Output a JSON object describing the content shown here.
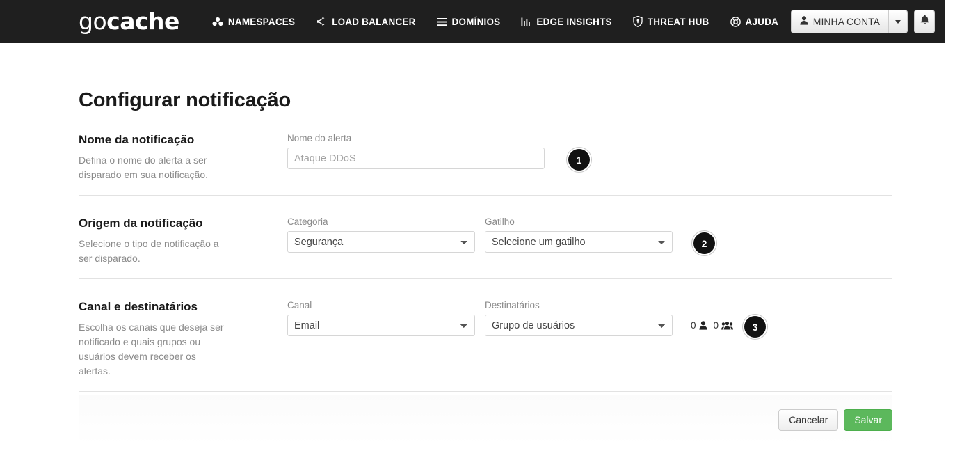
{
  "navbar": {
    "brand_go": "go",
    "brand_cache": "cache",
    "links": [
      {
        "label": "NAMESPACES",
        "icon": "cubes-icon"
      },
      {
        "label": "LOAD BALANCER",
        "icon": "share-nodes-icon"
      },
      {
        "label": "DOMÍNIOS",
        "icon": "bars-icon"
      },
      {
        "label": "EDGE INSIGHTS",
        "icon": "chart-bar-icon"
      },
      {
        "label": "THREAT HUB",
        "icon": "shield-icon"
      },
      {
        "label": "AJUDA",
        "icon": "life-ring-icon"
      }
    ],
    "account_label": "MINHA CONTA",
    "account_icon": "user-icon",
    "caret_icon": "caret-down-icon",
    "bell_icon": "bell-icon",
    "background_color": "#1f1f1f"
  },
  "page": {
    "title": "Configurar notificação"
  },
  "sections": [
    {
      "title": "Nome da notificação",
      "description": "Defina o nome do alerta a ser disparado em sua notificação.",
      "badge": "1",
      "fields": [
        {
          "label": "Nome do alerta",
          "type": "text",
          "value": "",
          "placeholder": "Ataque DDoS"
        }
      ]
    },
    {
      "title": "Origem da notificação",
      "description": "Selecione o tipo de notificação a ser disparado.",
      "badge": "2",
      "fields": [
        {
          "label": "Categoria",
          "type": "select",
          "value": "Segurança",
          "options": [
            "Segurança"
          ]
        },
        {
          "label": "Gatilho",
          "type": "select",
          "value": "Selecione um gatilho",
          "options": [
            "Selecione um gatilho"
          ]
        }
      ]
    },
    {
      "title": "Canal e destinatários",
      "description": "Escolha os canais que deseja ser notificado e quais grupos ou usuários devem receber os alertas.",
      "badge": "3",
      "fields": [
        {
          "label": "Canal",
          "type": "select",
          "value": "Email",
          "options": [
            "Email"
          ]
        },
        {
          "label": "Destinatários",
          "type": "select",
          "value": "Grupo de usuários",
          "options": [
            "Grupo de usuários"
          ]
        }
      ],
      "counters": [
        {
          "count": "0",
          "icon": "user-icon"
        },
        {
          "count": "0",
          "icon": "users-group-icon"
        }
      ]
    }
  ],
  "footer": {
    "cancel_label": "Cancelar",
    "save_label": "Salvar",
    "save_color": "#5cb85c"
  }
}
